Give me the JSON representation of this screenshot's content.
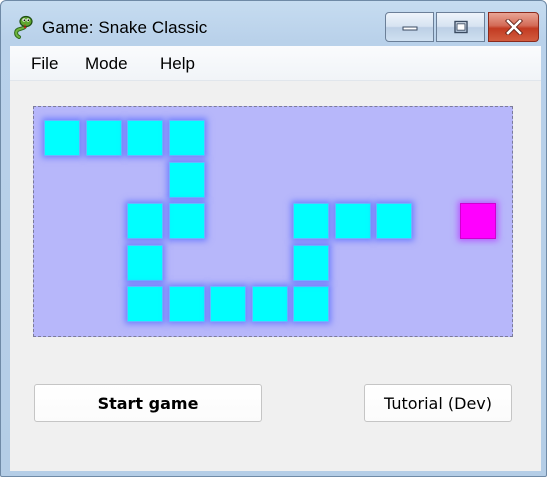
{
  "window": {
    "title": "Game: Snake Classic",
    "icon": "snake-icon",
    "controls": [
      "minimize-icon",
      "maximize-icon",
      "close-icon"
    ]
  },
  "menu": {
    "items": [
      {
        "label": "File"
      },
      {
        "label": "Mode"
      },
      {
        "label": "Help"
      }
    ]
  },
  "board": {
    "background_color": "#b7b7fa",
    "snake_color": "#00ffff",
    "food_color": "#ff00ff",
    "cols": 11,
    "rows": 5,
    "snake": [
      [
        0,
        0
      ],
      [
        1,
        0
      ],
      [
        2,
        0
      ],
      [
        3,
        0
      ],
      [
        3,
        1
      ],
      [
        3,
        2
      ],
      [
        2,
        2
      ],
      [
        2,
        3
      ],
      [
        2,
        4
      ],
      [
        3,
        4
      ],
      [
        4,
        4
      ],
      [
        5,
        4
      ],
      [
        6,
        4
      ],
      [
        6,
        3
      ],
      [
        6,
        2
      ],
      [
        7,
        2
      ],
      [
        8,
        2
      ]
    ],
    "food": [
      10,
      2
    ]
  },
  "buttons": {
    "start": "Start game",
    "tutorial": "Tutorial (Dev)"
  }
}
